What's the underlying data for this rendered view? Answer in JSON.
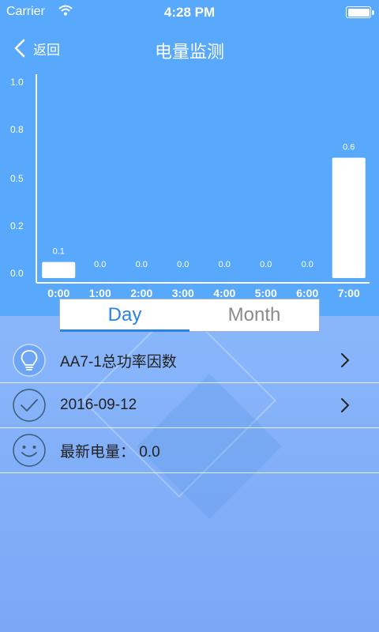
{
  "status_bar": {
    "carrier": "Carrier",
    "time": "4:28 PM"
  },
  "nav": {
    "back_label": "返回",
    "title": "电量监测"
  },
  "chart_data": {
    "type": "bar",
    "categories": [
      "0:00",
      "1:00",
      "2:00",
      "3:00",
      "4:00",
      "5:00",
      "6:00",
      "7:00"
    ],
    "values": [
      0.1,
      0.0,
      0.0,
      0.0,
      0.0,
      0.0,
      0.0,
      0.6
    ],
    "value_labels": [
      "0.1",
      "0.0",
      "0.0",
      "0.0",
      "0.0",
      "0.0",
      "0.0",
      "0.6"
    ],
    "y_ticks": [
      "0.0",
      "0.2",
      "0.5",
      "0.8",
      "1.0"
    ],
    "ylim": [
      0,
      1.0
    ],
    "bar_color": "#ffffff",
    "background": "#58a9fc"
  },
  "tabs": [
    {
      "label": "Day",
      "active": true
    },
    {
      "label": "Month",
      "active": false
    }
  ],
  "rows": [
    {
      "text": "AA7-1总功率因数",
      "icon": "lightbulb-icon"
    },
    {
      "text": "2016-09-12",
      "icon": "check-circle-icon"
    },
    {
      "text": "最新电量：  0.0",
      "icon": "smiley-icon"
    }
  ],
  "colors": {
    "accent": "#2a82e4",
    "header_blue": "#58a9fc",
    "icon_badge": "#6ea6f5"
  }
}
